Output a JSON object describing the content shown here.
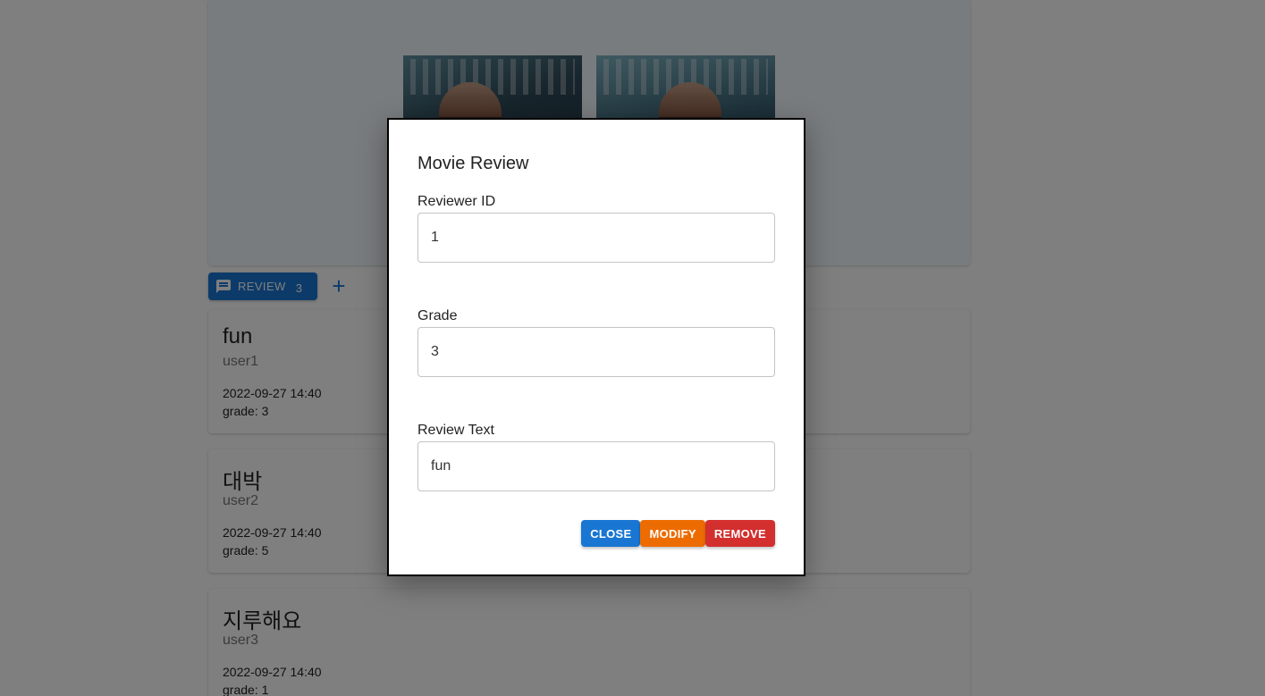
{
  "poster_section": {
    "posters": [
      {
        "name": "movie-poster-1"
      },
      {
        "name": "movie-poster-2"
      }
    ]
  },
  "review_tab": {
    "label": "REVIEW",
    "count": "3",
    "icon": "comment-icon",
    "add_symbol": "+"
  },
  "reviews": [
    {
      "title": "fun",
      "user": "user1",
      "date": "2022-09-27 14:40",
      "grade": "grade: 3"
    },
    {
      "title": "대박",
      "user": "user2",
      "date": "2022-09-27 14:40",
      "grade": "grade: 5"
    },
    {
      "title": "지루해요",
      "user": "user3",
      "date": "2022-09-27 14:40",
      "grade": "grade: 1"
    }
  ],
  "modal": {
    "title": "Movie Review",
    "reviewer_id": {
      "label": "Reviewer ID",
      "value": "1"
    },
    "grade": {
      "label": "Grade",
      "value": "3"
    },
    "review_text": {
      "label": "Review Text",
      "value": "fun"
    },
    "buttons": {
      "close": "CLOSE",
      "modify": "MODIFY",
      "remove": "REMOVE"
    }
  },
  "colors": {
    "primary": "#1976d2",
    "warning": "#ed6c02",
    "error": "#d32f2f"
  }
}
